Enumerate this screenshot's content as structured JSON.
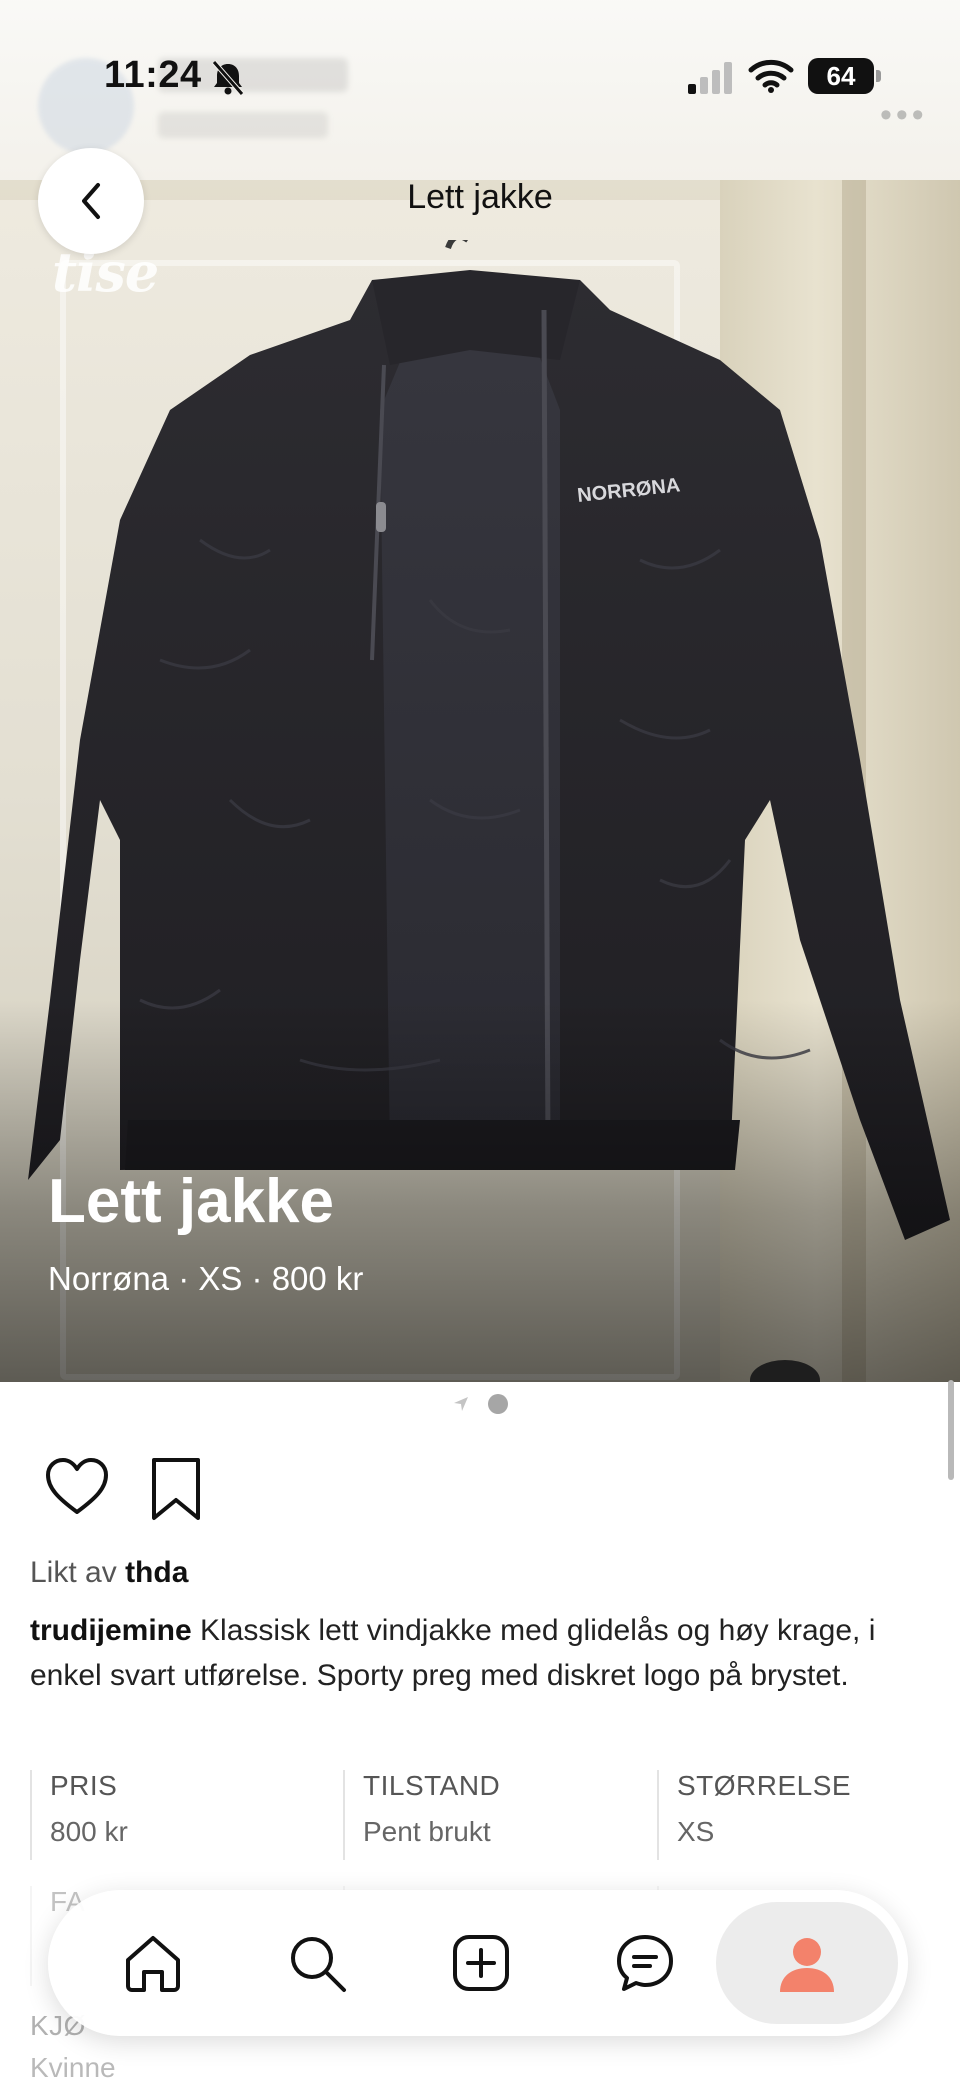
{
  "status_bar": {
    "time": "11:24",
    "battery": "64",
    "icons": [
      "bell-muted-icon",
      "cellular-signal-icon",
      "wifi-icon",
      "battery-icon"
    ]
  },
  "header": {
    "title": "Lett jakke",
    "back_icon": "chevron-left-icon"
  },
  "hero": {
    "watermark": "tise",
    "brand_on_jacket": "NORRØNA",
    "title": "Lett jakke",
    "meta": "Norrøna · XS · 800 kr",
    "page_count": 1,
    "current_page": 1
  },
  "actions": {
    "like_icon": "heart-icon",
    "save_icon": "bookmark-icon"
  },
  "likes": {
    "prefix": "Likt av",
    "user": "thda"
  },
  "post": {
    "author": "trudijemine",
    "text": "Klassisk lett vindjakke med glidelås og høy krage, i enkel svart utførelse. Sporty preg med diskret logo på brystet."
  },
  "details": [
    {
      "label": "PRIS",
      "value": "800 kr"
    },
    {
      "label": "TILSTAND",
      "value": "Pent brukt"
    },
    {
      "label": "STØRRELSE",
      "value": "XS"
    }
  ],
  "details_partial": [
    {
      "label": "FA",
      "value": ""
    }
  ],
  "details_extra": [
    {
      "label": "KJØ",
      "value": "Kvinne"
    }
  ],
  "bottom_nav": {
    "items": [
      "home-icon",
      "search-icon",
      "add-listing-icon",
      "messages-icon",
      "profile-icon"
    ],
    "active": "profile-icon",
    "accent_color": "#f3826b"
  }
}
